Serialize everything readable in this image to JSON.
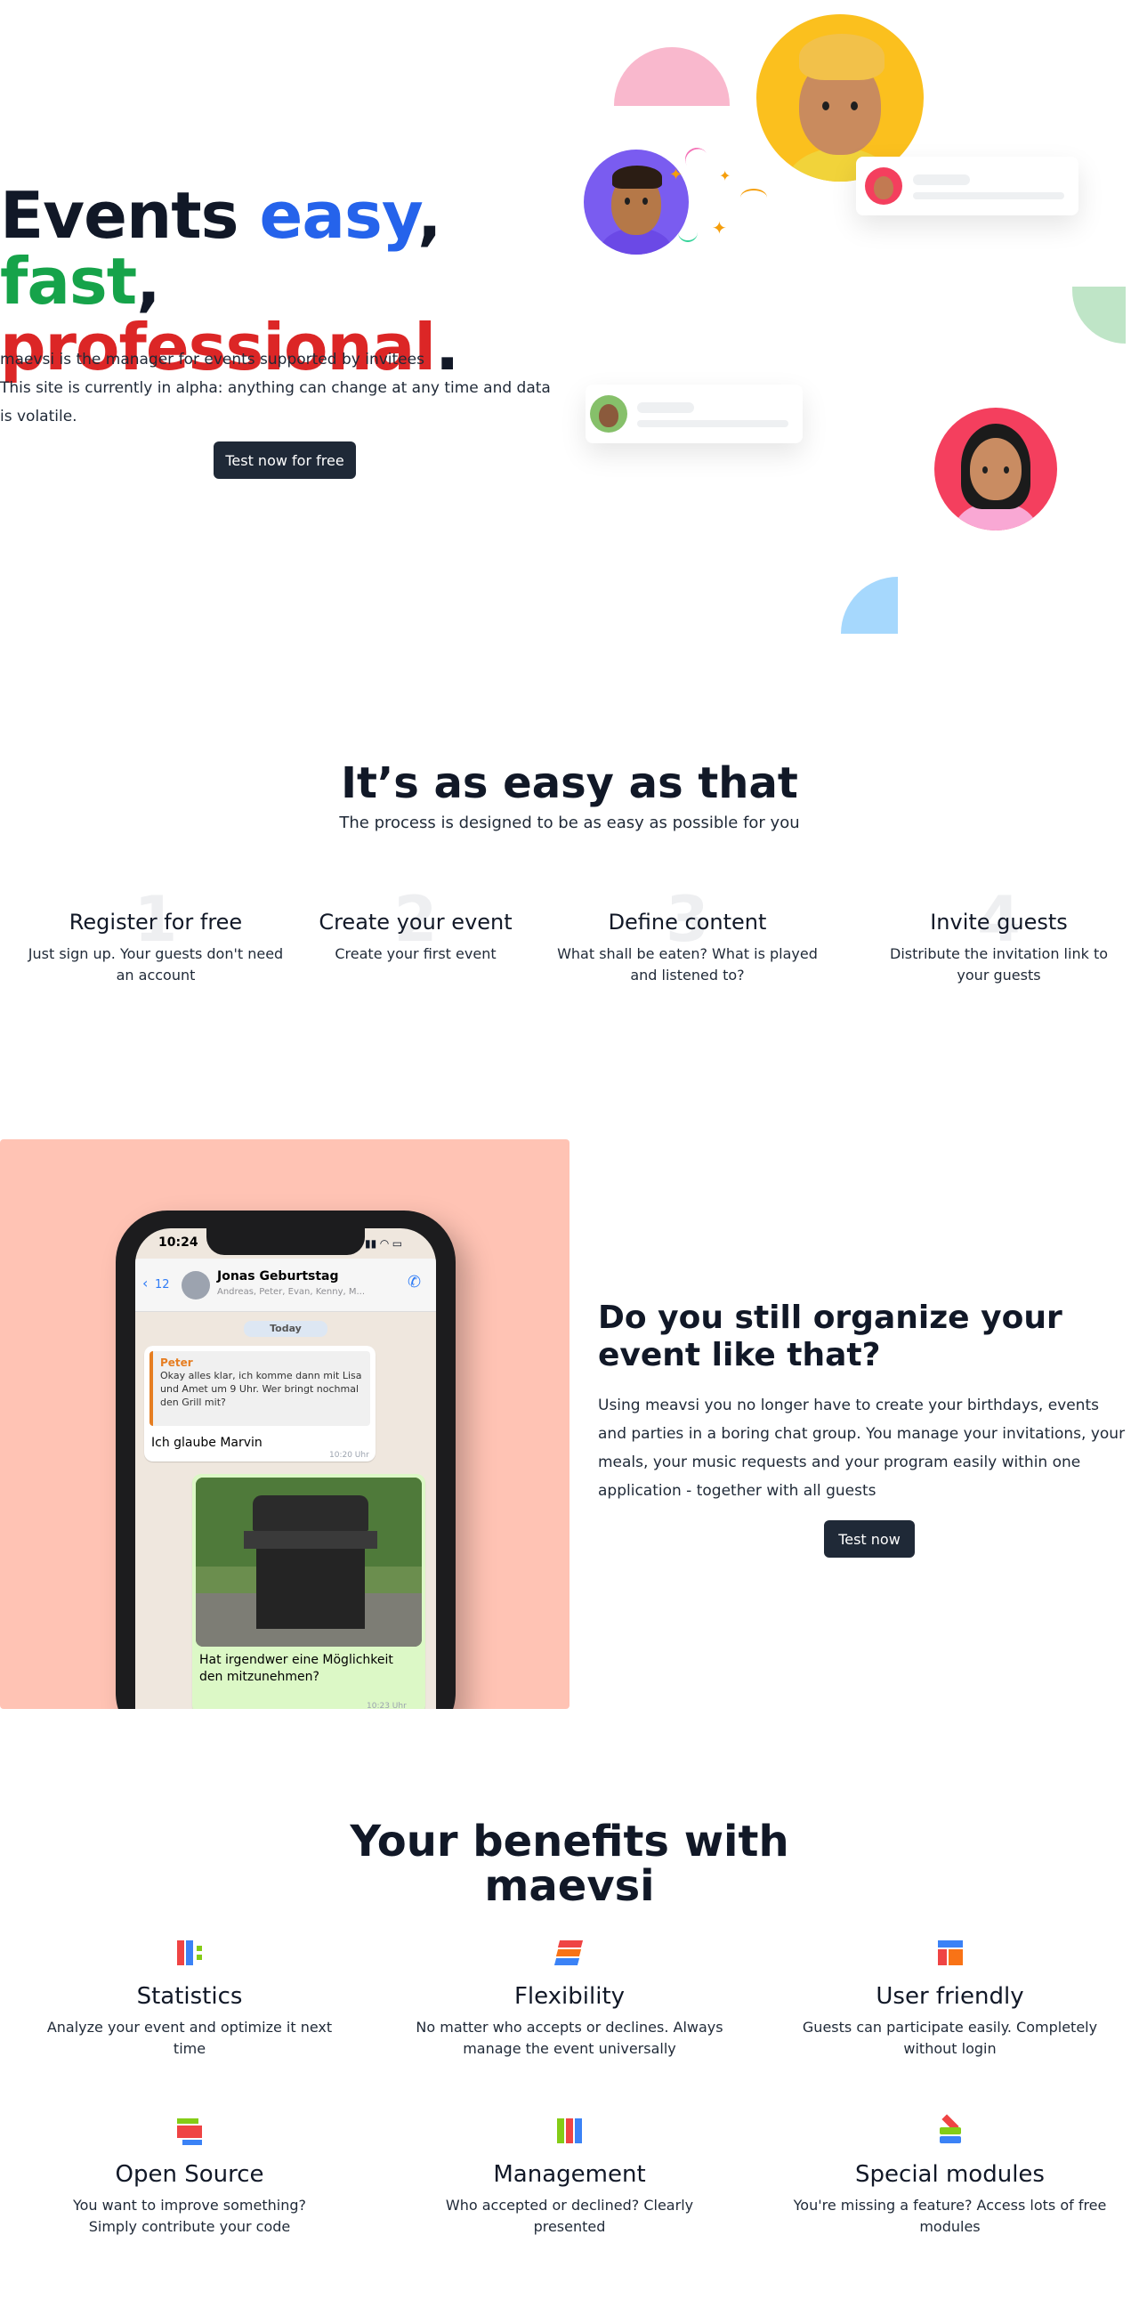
{
  "hero": {
    "title_part1": "Events ",
    "title_easy": "easy",
    "title_comma1": ", ",
    "title_fast": "fast",
    "title_comma2": ",",
    "title_professional": "professional",
    "title_period": ".",
    "subtitle_line1": "maevsi is the manager for events supported by invitees",
    "subtitle_line2": "This site is currently in alpha: anything can change at any time and data is volatile.",
    "cta_label": "Test now for free"
  },
  "process": {
    "title": "It’s as easy as that",
    "subtitle": "The process is designed to be as easy as possible for you",
    "steps": [
      {
        "number": "1",
        "title": "Register for free",
        "description": "Just sign up. Your guests don't need an account"
      },
      {
        "number": "2",
        "title": "Create your event",
        "description": "Create your first event"
      },
      {
        "number": "3",
        "title": "Define content",
        "description": "What shall be eaten? What is played and listened to?"
      },
      {
        "number": "4",
        "title": "Invite guests",
        "description": "Distribute the invitation link to your guests"
      }
    ]
  },
  "organize": {
    "title": "Do you still organize your event like that?",
    "text": "Using meavsi you no longer have to create your birthdays, events and parties in a boring chat group. You manage your invitations, your meals, your music requests and your program easily within one application - together with all guests",
    "cta_label": "Test now",
    "phone": {
      "time": "10:24",
      "back_count": "12",
      "chat_name": "Jonas Geburtstag",
      "chat_members": "Andreas, Peter, Evan, Kenny, M...",
      "date_label": "Today",
      "quote_author": "Peter",
      "quote_text": "Okay alles klar, ich komme dann mit Lisa und Amet um 9 Uhr. Wer bringt nochmal den Grill mit?",
      "reply_text": "Ich glaube Marvin",
      "reply_time": "10:20 Uhr",
      "image_caption": "Hat irgendwer eine Möglichkeit den mitzunehmen?",
      "image_time": "10:23 Uhr"
    }
  },
  "benefits": {
    "title": "Your benefits with maevsi",
    "items": [
      {
        "icon": "statistics-icon",
        "title": "Statistics",
        "description": "Analyze your event and optimize it next time"
      },
      {
        "icon": "flexibility-icon",
        "title": "Flexibility",
        "description": "No matter who accepts or declines. Always manage the event universally"
      },
      {
        "icon": "user-friendly-icon",
        "title": "User friendly",
        "description": "Guests can participate easily. Completely without login"
      },
      {
        "icon": "open-source-icon",
        "title": "Open Source",
        "description": "You want to improve something? Simply contribute your code"
      },
      {
        "icon": "management-icon",
        "title": "Management",
        "description": "Who accepted or declined? Clearly presented"
      },
      {
        "icon": "special-modules-icon",
        "title": "Special modules",
        "description": "You're missing a feature? Access lots of free modules"
      }
    ]
  },
  "colors": {
    "dark_button": "#1f2937",
    "blue": "#2563eb",
    "green": "#16a34a",
    "red": "#dc2626",
    "pink_panel": "#ffc3b4"
  }
}
